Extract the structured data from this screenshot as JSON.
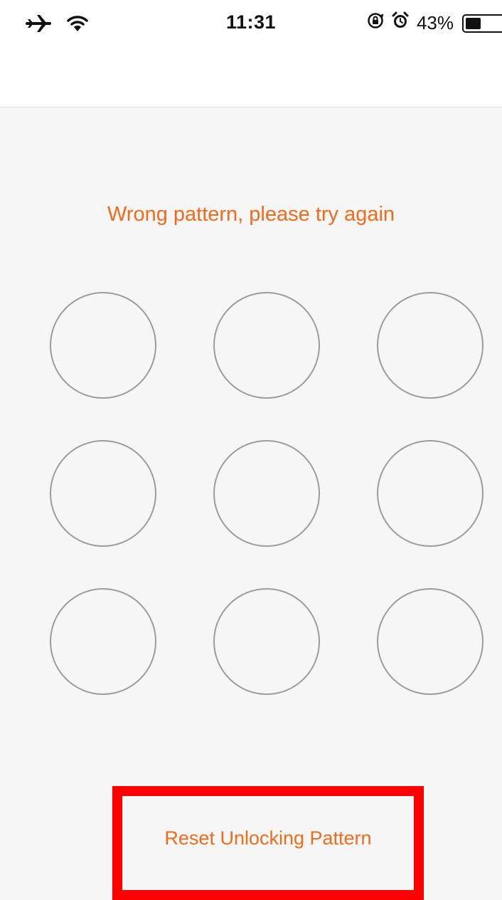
{
  "status_bar": {
    "time": "11:31",
    "battery_percent_label": "43%",
    "battery_level": 0.43,
    "icons": [
      "airplane-icon",
      "wifi-icon",
      "rotation-lock-icon",
      "alarm-icon",
      "battery-icon"
    ]
  },
  "unlock": {
    "message": "Wrong pattern, please try again",
    "message_color": "#f26b1d",
    "dots": [
      {
        "id": "1"
      },
      {
        "id": "2"
      },
      {
        "id": "3"
      },
      {
        "id": "4"
      },
      {
        "id": "5"
      },
      {
        "id": "6"
      },
      {
        "id": "7"
      },
      {
        "id": "8"
      },
      {
        "id": "9"
      }
    ]
  },
  "reset": {
    "label": "Reset Unlocking Pattern",
    "highlight_color": "#ff0000"
  }
}
